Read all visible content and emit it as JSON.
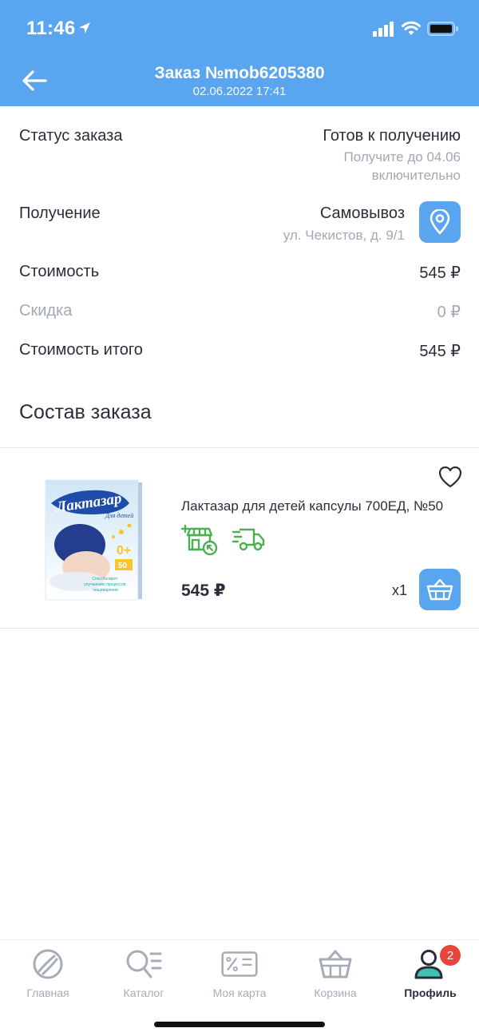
{
  "status_bar": {
    "time": "11:46"
  },
  "header": {
    "title": "Заказ №mob6205380",
    "subtitle": "02.06.2022 17:41"
  },
  "order": {
    "status": {
      "label": "Статус заказа",
      "value": "Готов к получению",
      "note_line1": "Получите до 04.06",
      "note_line2": "включительно"
    },
    "receiving": {
      "label": "Получение",
      "value": "Самовывоз",
      "address": "ул. Чекистов, д. 9/1"
    },
    "cost": {
      "label": "Стоимость",
      "value": "545 ₽"
    },
    "discount": {
      "label": "Скидка",
      "value": "0 ₽"
    },
    "total": {
      "label": "Стоимость итого",
      "value": "545 ₽"
    }
  },
  "composition": {
    "title": "Состав заказа",
    "items": [
      {
        "name": "Лактазар для детей капсулы 700ЕД, №50",
        "price": "545 ₽",
        "quantity": "x1",
        "image_text": {
          "brand": "Лактазар",
          "sub": "Для детей",
          "age": "0+",
          "count": "50",
          "claim": "Способствует улучшению процессов пищеварения"
        }
      }
    ]
  },
  "tabbar": {
    "tabs": [
      {
        "label": "Главная",
        "icon": "home-icon"
      },
      {
        "label": "Каталог",
        "icon": "catalog-icon"
      },
      {
        "label": "Моя карта",
        "icon": "card-icon"
      },
      {
        "label": "Корзина",
        "icon": "basket-icon"
      },
      {
        "label": "Профиль",
        "icon": "profile-icon",
        "badge": "2"
      }
    ]
  },
  "colors": {
    "accent": "#5aa5ef",
    "text": "#2b2e3a",
    "muted": "#a3a8b4",
    "green": "#4caf50",
    "badge": "#e8453c"
  }
}
